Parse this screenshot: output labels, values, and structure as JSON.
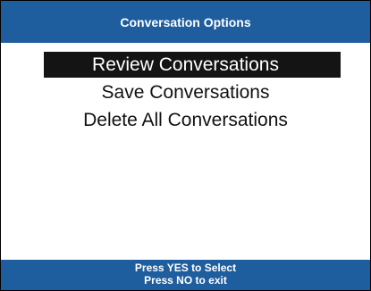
{
  "header": {
    "title": "Conversation Options"
  },
  "menu": {
    "items": [
      {
        "label": "Review Conversations",
        "selected": true
      },
      {
        "label": "Save Conversations",
        "selected": false
      },
      {
        "label": "Delete All Conversations",
        "selected": false
      }
    ]
  },
  "footer": {
    "line1": "Press YES to Select",
    "line2": "Press NO to exit"
  },
  "colors": {
    "bar": "#1f5e9e",
    "selection": "#141414",
    "background": "#ffffff"
  }
}
